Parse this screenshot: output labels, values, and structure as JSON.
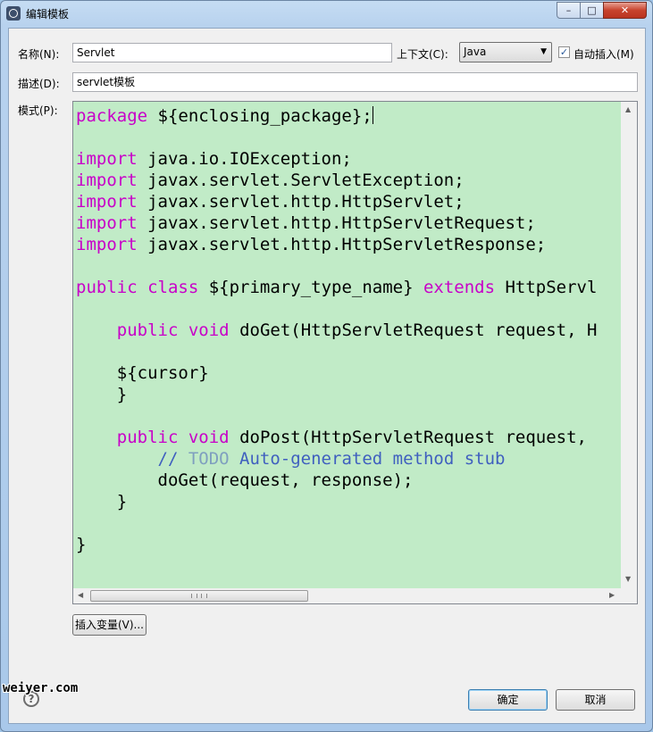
{
  "window": {
    "title": "编辑模板",
    "minimize": "–",
    "maximize": "□",
    "close": "✕"
  },
  "form": {
    "name_label": "名称(N):",
    "name_value": "Servlet",
    "context_label": "上下文(C):",
    "context_value": "Java",
    "auto_insert_label": "自动插入(M)",
    "auto_insert_checked": true,
    "desc_label": "描述(D):",
    "desc_value": "servlet模板",
    "pattern_label": "模式(P):"
  },
  "code": {
    "lines": [
      "package ${enclosing_package};",
      "",
      "import java.io.IOException;",
      "import javax.servlet.ServletException;",
      "import javax.servlet.http.HttpServlet;",
      "import javax.servlet.http.HttpServletRequest;",
      "import javax.servlet.http.HttpServletResponse;",
      "",
      "public class ${primary_type_name} extends HttpServl",
      "",
      "    public void doGet(HttpServletRequest request, H",
      "",
      "    ${cursor}",
      "    }",
      "",
      "    public void doPost(HttpServletRequest request,",
      "        // TODO Auto-generated method stub",
      "        doGet(request, response);",
      "    }",
      "",
      "}"
    ],
    "keyword_color": "#c800c8",
    "comment_color": "#3f5fbf",
    "background_color": "#c1ebc7"
  },
  "buttons": {
    "insert_variable": "插入变量(V)...",
    "ok": "确定",
    "cancel": "取消"
  },
  "help_icon": "?",
  "watermark": "weiyer.com"
}
